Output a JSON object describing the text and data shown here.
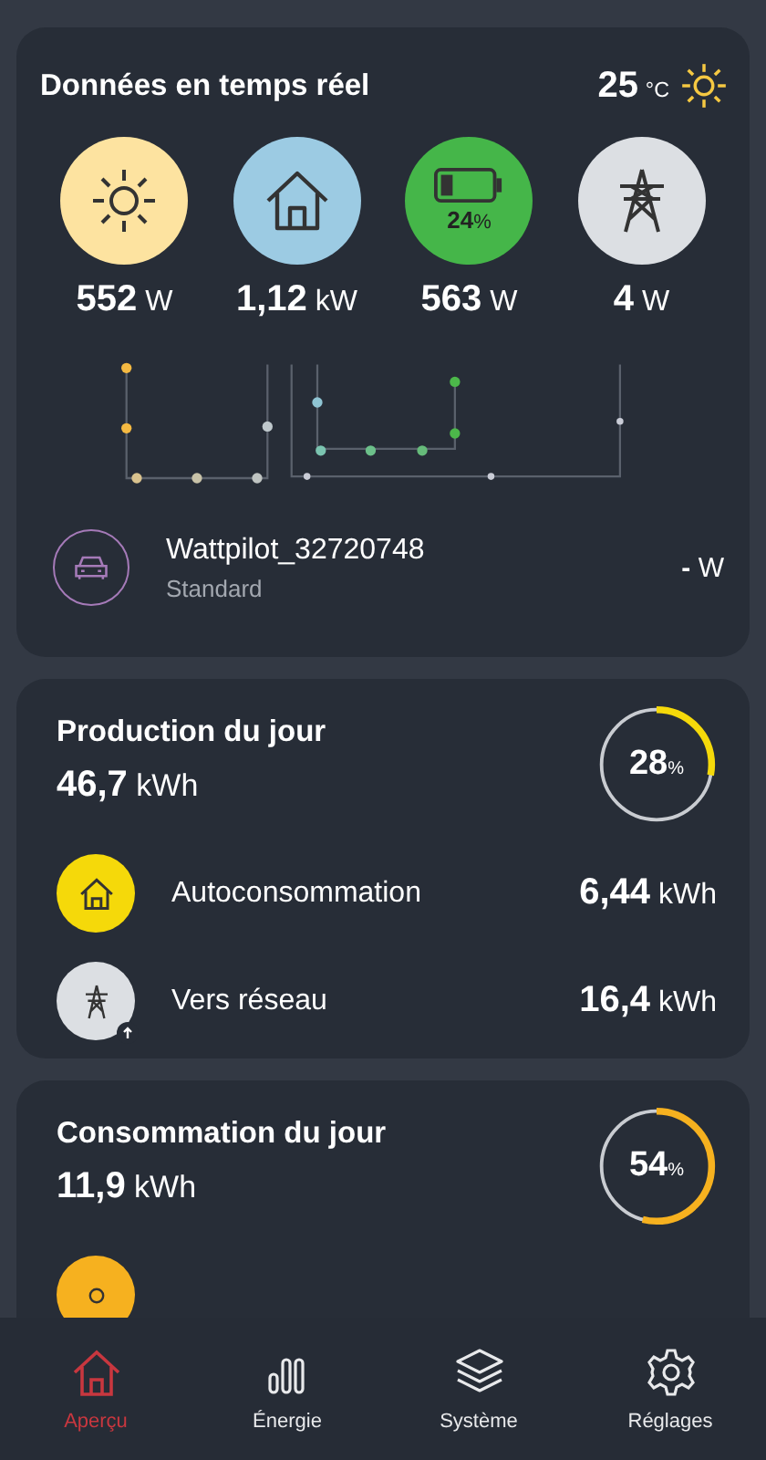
{
  "realtime": {
    "title": "Données en temps réel",
    "temperature": {
      "value": "25",
      "unit": "°C"
    },
    "sources": [
      {
        "kind": "solar",
        "value": "552",
        "unit": "W"
      },
      {
        "kind": "home",
        "value": "1,12",
        "unit": "kW"
      },
      {
        "kind": "battery",
        "value": "563",
        "unit": "W",
        "percent": "24",
        "percent_unit": "%",
        "level": 0.24
      },
      {
        "kind": "grid",
        "value": "4",
        "unit": "W"
      }
    ],
    "charger": {
      "name": "Wattpilot_32720748",
      "mode": "Standard",
      "value": "-",
      "unit": "W"
    }
  },
  "cards": [
    {
      "title": "Production du jour",
      "value": "46,7",
      "unit": "kWh",
      "percent": "28",
      "percent_unit": "%",
      "level": 0.28,
      "color": "#f5d90a",
      "rows": [
        {
          "kind": "home",
          "label": "Autoconsommation",
          "value": "6,44",
          "unit": "kWh"
        },
        {
          "kind": "grid",
          "label": "Vers réseau",
          "value": "16,4",
          "unit": "kWh"
        }
      ]
    },
    {
      "title": "Consommation du jour",
      "value": "11,9",
      "unit": "kWh",
      "percent": "54",
      "percent_unit": "%",
      "level": 0.54,
      "color": "#f6b11f",
      "rows": [
        {
          "kind": "solar"
        }
      ]
    }
  ],
  "nav": [
    {
      "kind": "home",
      "label": "Aperçu",
      "selected": true
    },
    {
      "kind": "energy",
      "label": "Énergie",
      "selected": false
    },
    {
      "kind": "system",
      "label": "Système",
      "selected": false
    },
    {
      "kind": "settings",
      "label": "Réglages",
      "selected": false
    }
  ]
}
